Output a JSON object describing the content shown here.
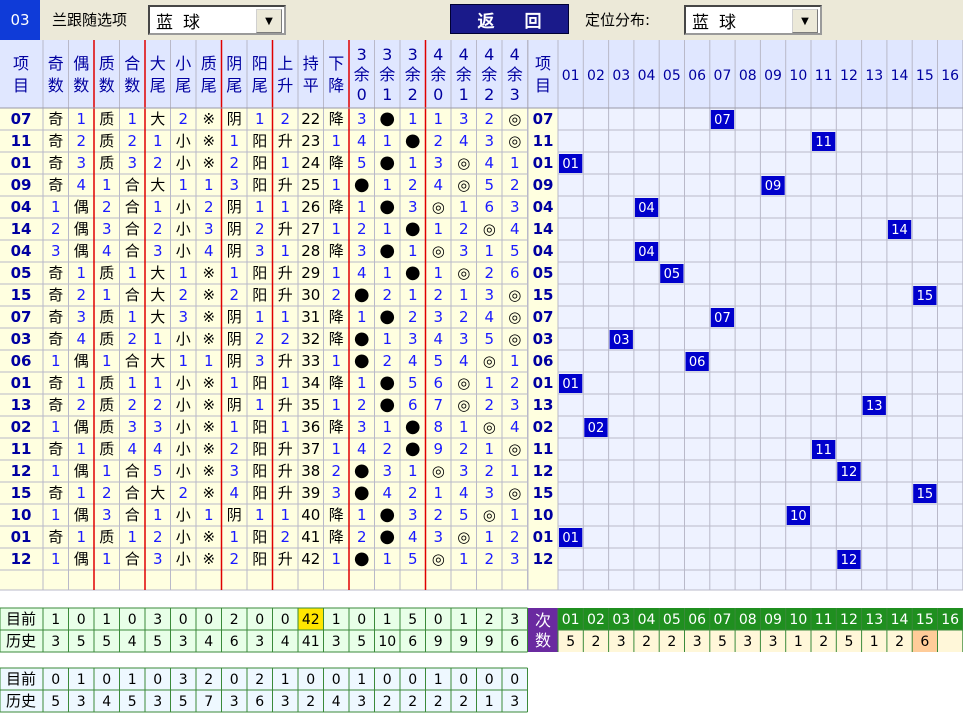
{
  "top": {
    "lotto_no": "03",
    "follow_label": "兰跟随选项",
    "follow_select": "蓝球",
    "back_button": "返 回",
    "position_label": "定位分布:",
    "position_select": "蓝球",
    "dropdown_icon": "chevron-down-icon"
  },
  "colors": {
    "header_bg": "#e0e7ff",
    "left_bg": "#ffffe0",
    "right_bg": "#eef2ff",
    "ball_bg": "#0000cc",
    "ball_text": "#ffffff",
    "item_text": "#0000a0",
    "omit_text": "#3b50ff",
    "grid_red": "#e00000",
    "lower_green": "#1f8f1f",
    "purple": "#6a2aa0",
    "highlight_yellow": "#ffe600",
    "peach": "#ffcc99"
  },
  "table": {
    "item_header": "项目",
    "columns": [
      "奇数",
      "偶数",
      "质数",
      "合数",
      "大尾",
      "小尾",
      "质尾",
      "阴尾",
      "阳尾",
      "上升",
      "持平",
      "下降",
      "3余0",
      "3余1",
      "3余2",
      "4余0",
      "4余1",
      "4余2",
      "4余3"
    ],
    "position_header": "项目",
    "positions": [
      "01",
      "02",
      "03",
      "04",
      "05",
      "06",
      "07",
      "08",
      "09",
      "10",
      "11",
      "12",
      "13",
      "14",
      "15",
      "16"
    ],
    "rows": [
      {
        "num": "07",
        "cells": [
          "奇",
          "1",
          "质",
          "1",
          "大",
          "2",
          "※",
          "阴",
          "1",
          "2",
          "22",
          "降",
          "3",
          "●",
          "1",
          "1",
          "3",
          "2",
          "◎"
        ]
      },
      {
        "num": "11",
        "cells": [
          "奇",
          "2",
          "质",
          "2",
          "1",
          "小",
          "※",
          "1",
          "阳",
          "升",
          "23",
          "1",
          "4",
          "1",
          "●",
          "2",
          "4",
          "3",
          "◎"
        ]
      },
      {
        "num": "01",
        "cells": [
          "奇",
          "3",
          "质",
          "3",
          "2",
          "小",
          "※",
          "2",
          "阳",
          "1",
          "24",
          "降",
          "5",
          "●",
          "1",
          "3",
          "◎",
          "4",
          "1"
        ]
      },
      {
        "num": "09",
        "cells": [
          "奇",
          "4",
          "1",
          "合",
          "大",
          "1",
          "1",
          "3",
          "阳",
          "升",
          "25",
          "1",
          "●",
          "1",
          "2",
          "4",
          "◎",
          "5",
          "2"
        ]
      },
      {
        "num": "04",
        "cells": [
          "1",
          "偶",
          "2",
          "合",
          "1",
          "小",
          "2",
          "阴",
          "1",
          "1",
          "26",
          "降",
          "1",
          "●",
          "3",
          "◎",
          "1",
          "6",
          "3"
        ]
      },
      {
        "num": "14",
        "cells": [
          "2",
          "偶",
          "3",
          "合",
          "2",
          "小",
          "3",
          "阴",
          "2",
          "升",
          "27",
          "1",
          "2",
          "1",
          "●",
          "1",
          "2",
          "◎",
          "4"
        ]
      },
      {
        "num": "04",
        "cells": [
          "3",
          "偶",
          "4",
          "合",
          "3",
          "小",
          "4",
          "阴",
          "3",
          "1",
          "28",
          "降",
          "3",
          "●",
          "1",
          "◎",
          "3",
          "1",
          "5"
        ]
      },
      {
        "num": "05",
        "cells": [
          "奇",
          "1",
          "质",
          "1",
          "大",
          "1",
          "※",
          "1",
          "阳",
          "升",
          "29",
          "1",
          "4",
          "1",
          "●",
          "1",
          "◎",
          "2",
          "6"
        ]
      },
      {
        "num": "15",
        "cells": [
          "奇",
          "2",
          "1",
          "合",
          "大",
          "2",
          "※",
          "2",
          "阳",
          "升",
          "30",
          "2",
          "●",
          "2",
          "1",
          "2",
          "1",
          "3",
          "◎"
        ]
      },
      {
        "num": "07",
        "cells": [
          "奇",
          "3",
          "质",
          "1",
          "大",
          "3",
          "※",
          "阴",
          "1",
          "1",
          "31",
          "降",
          "1",
          "●",
          "2",
          "3",
          "2",
          "4",
          "◎"
        ]
      },
      {
        "num": "03",
        "cells": [
          "奇",
          "4",
          "质",
          "2",
          "1",
          "小",
          "※",
          "阴",
          "2",
          "2",
          "32",
          "降",
          "●",
          "1",
          "3",
          "4",
          "3",
          "5",
          "◎"
        ]
      },
      {
        "num": "06",
        "cells": [
          "1",
          "偶",
          "1",
          "合",
          "大",
          "1",
          "1",
          "阴",
          "3",
          "升",
          "33",
          "1",
          "●",
          "2",
          "4",
          "5",
          "4",
          "◎",
          "1"
        ]
      },
      {
        "num": "01",
        "cells": [
          "奇",
          "1",
          "质",
          "1",
          "1",
          "小",
          "※",
          "1",
          "阳",
          "1",
          "34",
          "降",
          "1",
          "●",
          "5",
          "6",
          "◎",
          "1",
          "2"
        ]
      },
      {
        "num": "13",
        "cells": [
          "奇",
          "2",
          "质",
          "2",
          "2",
          "小",
          "※",
          "阴",
          "1",
          "升",
          "35",
          "1",
          "2",
          "●",
          "6",
          "7",
          "◎",
          "2",
          "3"
        ]
      },
      {
        "num": "02",
        "cells": [
          "1",
          "偶",
          "质",
          "3",
          "3",
          "小",
          "※",
          "1",
          "阳",
          "1",
          "36",
          "降",
          "3",
          "1",
          "●",
          "8",
          "1",
          "◎",
          "4"
        ]
      },
      {
        "num": "11",
        "cells": [
          "奇",
          "1",
          "质",
          "4",
          "4",
          "小",
          "※",
          "2",
          "阳",
          "升",
          "37",
          "1",
          "4",
          "2",
          "●",
          "9",
          "2",
          "1",
          "◎"
        ]
      },
      {
        "num": "12",
        "cells": [
          "1",
          "偶",
          "1",
          "合",
          "5",
          "小",
          "※",
          "3",
          "阳",
          "升",
          "38",
          "2",
          "●",
          "3",
          "1",
          "◎",
          "3",
          "2",
          "1"
        ]
      },
      {
        "num": "15",
        "cells": [
          "奇",
          "1",
          "2",
          "合",
          "大",
          "2",
          "※",
          "4",
          "阳",
          "升",
          "39",
          "3",
          "●",
          "4",
          "2",
          "1",
          "4",
          "3",
          "◎"
        ]
      },
      {
        "num": "10",
        "cells": [
          "1",
          "偶",
          "3",
          "合",
          "1",
          "小",
          "1",
          "阴",
          "1",
          "1",
          "40",
          "降",
          "1",
          "●",
          "3",
          "2",
          "5",
          "◎",
          "1"
        ]
      },
      {
        "num": "01",
        "cells": [
          "奇",
          "1",
          "质",
          "1",
          "2",
          "小",
          "※",
          "1",
          "阳",
          "2",
          "41",
          "降",
          "2",
          "●",
          "4",
          "3",
          "◎",
          "1",
          "2"
        ]
      },
      {
        "num": "12",
        "cells": [
          "1",
          "偶",
          "1",
          "合",
          "3",
          "小",
          "※",
          "2",
          "阳",
          "升",
          "42",
          "1",
          "●",
          "1",
          "5",
          "◎",
          "1",
          "2",
          "3"
        ]
      }
    ]
  },
  "stats": {
    "current_label": "目前",
    "history_label": "历史",
    "current": [
      "1",
      "0",
      "1",
      "0",
      "3",
      "0",
      "0",
      "2",
      "0",
      "0",
      "42",
      "1",
      "0",
      "1",
      "5",
      "0",
      "1",
      "2",
      "3"
    ],
    "history": [
      "3",
      "5",
      "5",
      "4",
      "5",
      "3",
      "4",
      "6",
      "3",
      "4",
      "41",
      "3",
      "5",
      "10",
      "6",
      "9",
      "9",
      "9",
      "6"
    ],
    "count_label": "次数",
    "count_positions": [
      "01",
      "02",
      "03",
      "04",
      "05",
      "06",
      "07",
      "08",
      "09",
      "10",
      "11",
      "12",
      "13",
      "14",
      "15",
      "16"
    ],
    "counts": [
      "5",
      "2",
      "3",
      "2",
      "2",
      "3",
      "5",
      "3",
      "3",
      "1",
      "2",
      "5",
      "1",
      "2",
      "6",
      ""
    ],
    "current2": [
      "0",
      "1",
      "0",
      "1",
      "0",
      "3",
      "2",
      "0",
      "2",
      "1",
      "0",
      "0",
      "1",
      "0",
      "0",
      "1",
      "0",
      "0",
      "0"
    ],
    "history2": [
      "5",
      "3",
      "4",
      "5",
      "3",
      "5",
      "7",
      "3",
      "6",
      "3",
      "2",
      "4",
      "3",
      "2",
      "2",
      "2",
      "2",
      "1",
      "3"
    ]
  }
}
